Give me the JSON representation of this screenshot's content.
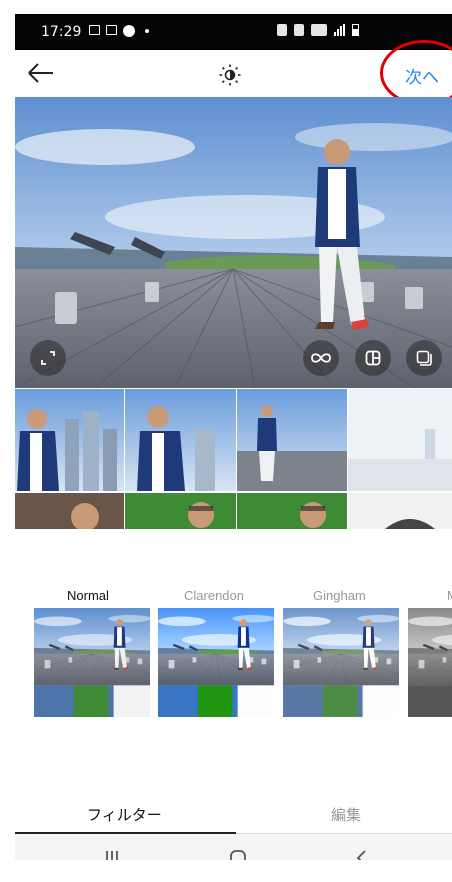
{
  "status": {
    "time": "17:29",
    "left_icons": [
      "gallery-icon",
      "mail-icon",
      "check-circle-icon",
      "dot-icon"
    ],
    "right_icons": [
      "alarm-icon",
      "mute-icon",
      "wifi-icon",
      "signal-icon",
      "battery-icon"
    ]
  },
  "topbar": {
    "back_icon": "arrow-left-icon",
    "center_icon": "brightness-icon",
    "next_label": "次へ"
  },
  "preview": {
    "overlay_icons": [
      "expand-icon",
      "boomerang-icon",
      "layout-icon",
      "multi-select-icon"
    ]
  },
  "filters": [
    {
      "label": "Normal",
      "selected": true
    },
    {
      "label": "Clarendon",
      "selected": false
    },
    {
      "label": "Gingham",
      "selected": false
    },
    {
      "label": "M",
      "selected": false
    }
  ],
  "tabs": [
    {
      "label": "フィルター",
      "active": true
    },
    {
      "label": "編集",
      "active": false
    }
  ],
  "navbar": {
    "icons": [
      "recent-apps-icon",
      "home-icon",
      "back-nav-icon"
    ]
  },
  "colors": {
    "accent": "#1e8bf0",
    "highlight": "#e00000",
    "statusbar": "#050505"
  }
}
